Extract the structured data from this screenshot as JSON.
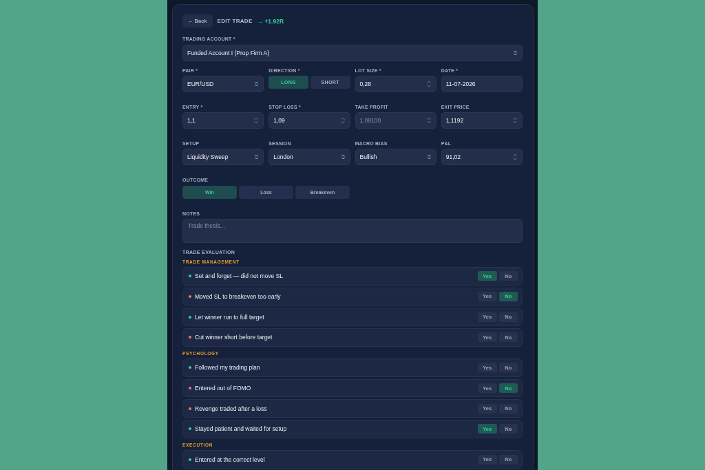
{
  "header": {
    "back": "← Back",
    "title": "EDIT TRADE",
    "result": "→ +1.92R"
  },
  "account": {
    "label": "TRADING ACCOUNT *",
    "value": "Funded Account I (Prop Firm A)"
  },
  "fields": [
    {
      "kind": "select",
      "label": "PAIR *",
      "value": "EUR/USD"
    },
    {
      "kind": "toggle",
      "label": "DIRECTION *",
      "options": [
        {
          "label": "LONG",
          "selected": true
        },
        {
          "label": "SHORT",
          "selected": false
        }
      ]
    },
    {
      "kind": "number",
      "label": "LOT SIZE *",
      "value": "0,28"
    },
    {
      "kind": "date",
      "label": "DATE *",
      "value": "11-07-2026"
    },
    {
      "kind": "number",
      "label": "ENTRY *",
      "value": "1,1"
    },
    {
      "kind": "number",
      "label": "STOP LOSS *",
      "value": "1,09"
    },
    {
      "kind": "number",
      "label": "TAKE PROFIT",
      "placeholder": "1.09100"
    },
    {
      "kind": "number",
      "label": "EXIT PRICE",
      "value": "1,1192"
    },
    {
      "kind": "select",
      "label": "SETUP",
      "value": "Liquidity Sweep"
    },
    {
      "kind": "select",
      "label": "SESSION",
      "value": "London"
    },
    {
      "kind": "select",
      "label": "MACRO BIAS",
      "value": "Bullish"
    },
    {
      "kind": "number",
      "label": "P&L",
      "value": "91,02"
    }
  ],
  "outcome": {
    "label": "OUTCOME",
    "options": [
      {
        "label": "Win",
        "selected": true
      },
      {
        "label": "Loss",
        "selected": false
      },
      {
        "label": "Breakeven",
        "selected": false
      }
    ]
  },
  "notes": {
    "label": "NOTES",
    "placeholder": "Trade thesis..."
  },
  "evaluation": {
    "title": "TRADE EVALUATION",
    "groups": [
      {
        "title": "TRADE MANAGEMENT",
        "items": [
          {
            "text": "Set and forget — did not move SL",
            "color": "#34d399",
            "buttons": [
              {
                "label": "Yes",
                "selected": true
              },
              {
                "label": "No",
                "selected": false
              }
            ]
          },
          {
            "text": "Moved SL to breakeven too early",
            "color": "#f87171",
            "buttons": [
              {
                "label": "Yes",
                "selected": false
              },
              {
                "label": "No",
                "selected": true
              }
            ]
          },
          {
            "text": "Let winner run to full target",
            "color": "#34d399",
            "buttons": [
              {
                "label": "Yes",
                "selected": false
              },
              {
                "label": "No",
                "selected": false
              }
            ]
          },
          {
            "text": "Cut winner short before target",
            "color": "#f87171",
            "buttons": [
              {
                "label": "Yes",
                "selected": false
              },
              {
                "label": "No",
                "selected": false
              }
            ]
          }
        ]
      },
      {
        "title": "PSYCHOLOGY",
        "items": [
          {
            "text": "Followed my trading plan",
            "color": "#34d399",
            "buttons": [
              {
                "label": "Yes",
                "selected": false
              },
              {
                "label": "No",
                "selected": false
              }
            ]
          },
          {
            "text": "Entered out of FOMO",
            "color": "#f87171",
            "buttons": [
              {
                "label": "Yes",
                "selected": false
              },
              {
                "label": "No",
                "selected": true
              }
            ]
          },
          {
            "text": "Revenge traded after a loss",
            "color": "#f87171",
            "buttons": [
              {
                "label": "Yes",
                "selected": false
              },
              {
                "label": "No",
                "selected": false
              }
            ]
          },
          {
            "text": "Stayed patient and waited for setup",
            "color": "#34d399",
            "buttons": [
              {
                "label": "Yes",
                "selected": true
              },
              {
                "label": "No",
                "selected": false
              }
            ]
          }
        ]
      },
      {
        "title": "EXECUTION",
        "items": [
          {
            "text": "Entered at the correct level",
            "color": "#34d399",
            "buttons": [
              {
                "label": "Yes",
                "selected": false
              },
              {
                "label": "No",
                "selected": false
              }
            ]
          }
        ]
      }
    ]
  }
}
